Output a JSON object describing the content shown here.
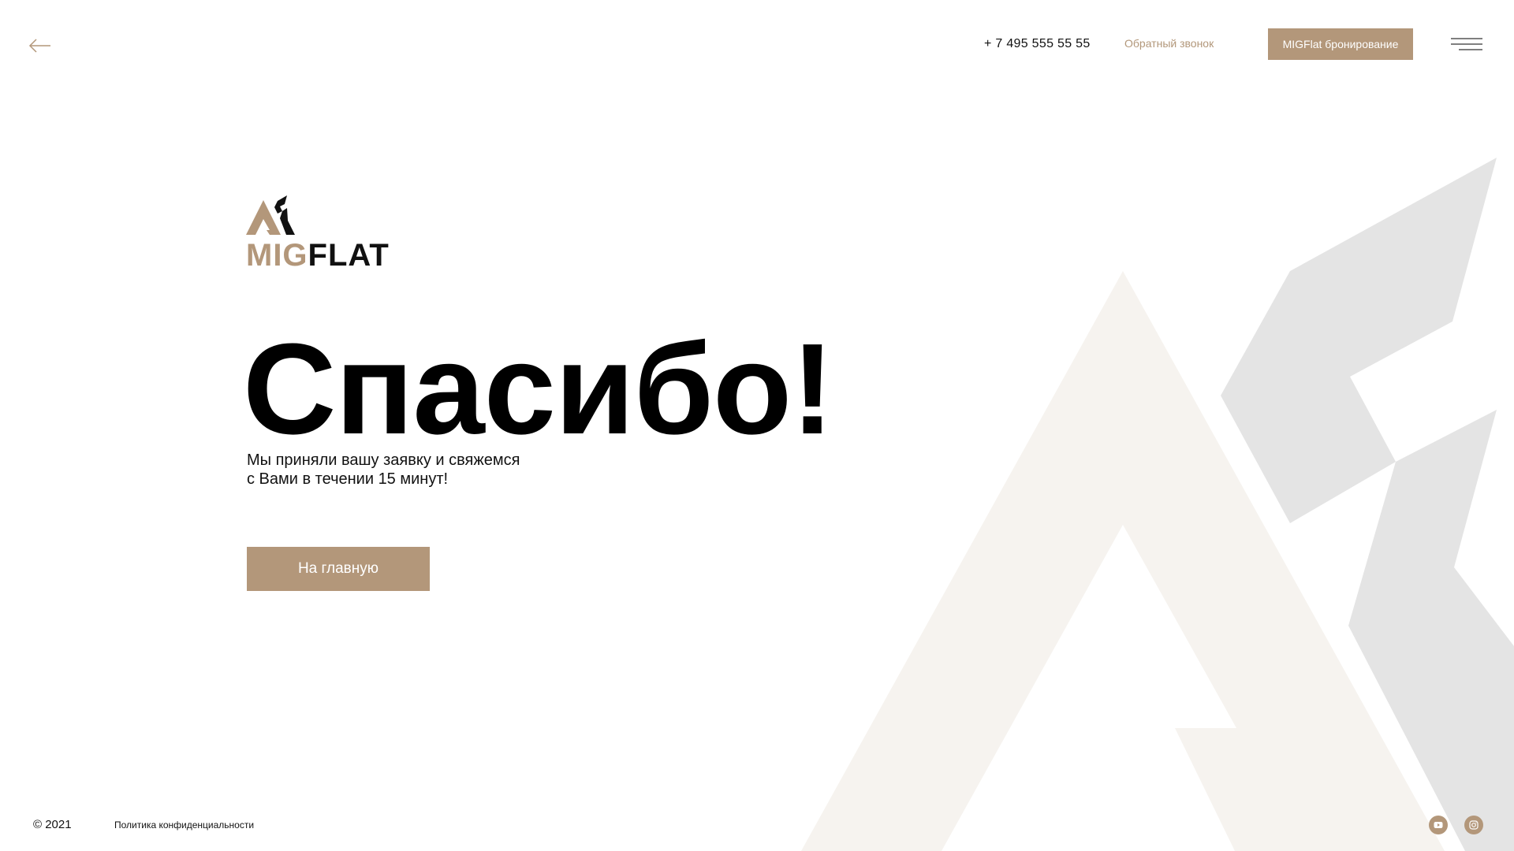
{
  "header": {
    "phone": "+ 7 495 555 55 55",
    "callback": "Обратный звонок",
    "booking_button": "MIGFlat бронирование"
  },
  "logo": {
    "mig": "MIG",
    "flat": "FLAT"
  },
  "main": {
    "title": "Спасибо!",
    "message_line1": "Мы приняли вашу заявку и свяжемся",
    "message_line2": "с Вами в течении 15 минут!",
    "home_button": "На главную"
  },
  "footer": {
    "copyright": "© 2021",
    "privacy": "Политика конфиденциальности"
  },
  "icons": {
    "back": "arrow-left-icon",
    "menu": "hamburger-menu-icon",
    "youtube": "youtube-icon",
    "instagram": "instagram-icon"
  },
  "colors": {
    "accent": "#b3977a",
    "deco_light": "#f6f3ef",
    "deco_gray": "#e4e4e4",
    "text": "#000000"
  }
}
